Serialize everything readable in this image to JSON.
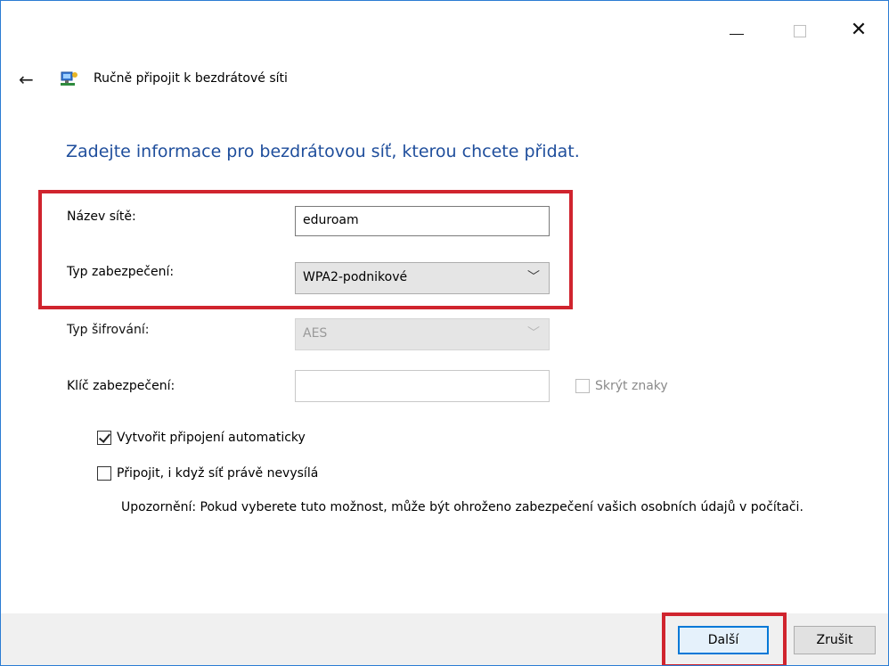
{
  "window": {
    "title": "Ručně připojit k bezdrátové síti",
    "controls": {
      "minimize": "—",
      "maximize": "☐",
      "close": "✕"
    }
  },
  "heading": "Zadejte informace pro bezdrátovou síť, kterou chcete přidat.",
  "fields": {
    "network_name": {
      "label": "Název sítě:",
      "value": "eduroam"
    },
    "security_type": {
      "label": "Typ zabezpečení:",
      "value": "WPA2-podnikové"
    },
    "encryption_type": {
      "label": "Typ šifrování:",
      "value": "AES"
    },
    "security_key": {
      "label": "Klíč zabezpečení:",
      "value": ""
    },
    "hide_chars": {
      "label": "Skrýt znaky",
      "checked": false
    }
  },
  "options": {
    "auto_connect": {
      "label": "Vytvořit připojení automaticky",
      "checked": true
    },
    "connect_hidden": {
      "label": "Připojit, i když síť právě nevysílá",
      "checked": false
    },
    "warning": "Upozornění: Pokud vyberete tuto možnost, může být ohroženo zabezpečení vašich osobních údajů v počítači."
  },
  "buttons": {
    "next": "Další",
    "cancel": "Zrušit"
  },
  "colors": {
    "heading": "#1f4e9c",
    "highlight": "#d0242e",
    "accent": "#0078d7"
  },
  "icons": {
    "back": "back-arrow-icon",
    "wizard": "network-icon"
  }
}
